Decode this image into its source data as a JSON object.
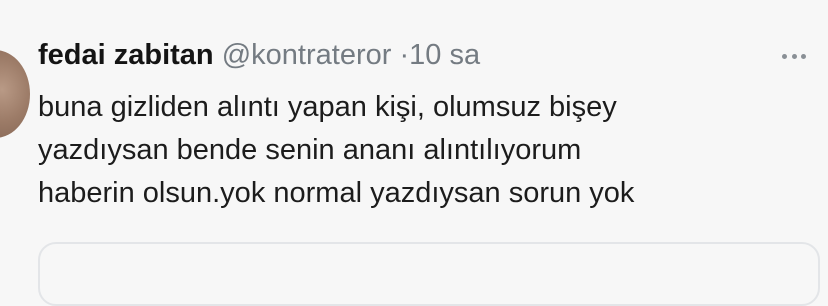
{
  "tweet": {
    "display_name": "fedai zabitan",
    "handle": "@kontrateror",
    "separator": "·",
    "time": "10 sa",
    "body_lines": [
      "buna gizliden alıntı yapan kişi, olumsuz bişey",
      "yazdıysan bende senin ananı alıntılıyorum",
      "haberin olsun.yok normal yazdıysan sorun yok"
    ],
    "more_icon": "more-horizontal-icon",
    "colors": {
      "name": "#141414",
      "secondary": "#747b82",
      "body": "#1c1c1c",
      "background": "#f7f7f7",
      "card_border": "#e3e5e8"
    }
  }
}
